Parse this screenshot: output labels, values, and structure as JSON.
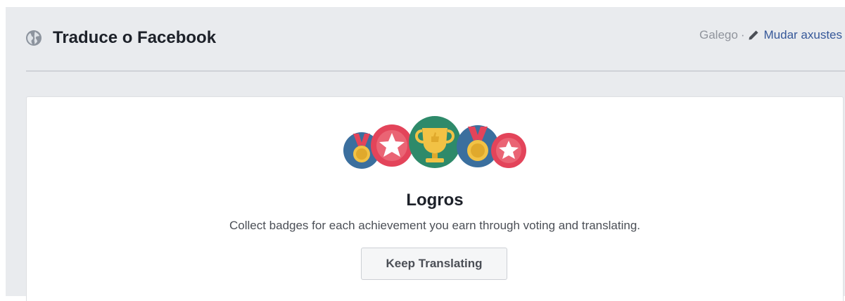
{
  "header": {
    "title": "Traduce o Facebook",
    "language": "Galego",
    "separator": "·",
    "settings_link": "Mudar axustes"
  },
  "achievements": {
    "title": "Logros",
    "description": "Collect badges for each achievement you earn through voting and translating.",
    "button_label": "Keep Translating"
  },
  "colors": {
    "background": "#e9ebee",
    "link": "#365899",
    "badge_blue": "#3b6f9e",
    "badge_red": "#e3445a",
    "badge_green": "#2e8a6a",
    "badge_gold": "#f2c245"
  },
  "icons": [
    "globe-icon",
    "pencil-icon",
    "medal-icon",
    "star-icon",
    "trophy-icon"
  ]
}
